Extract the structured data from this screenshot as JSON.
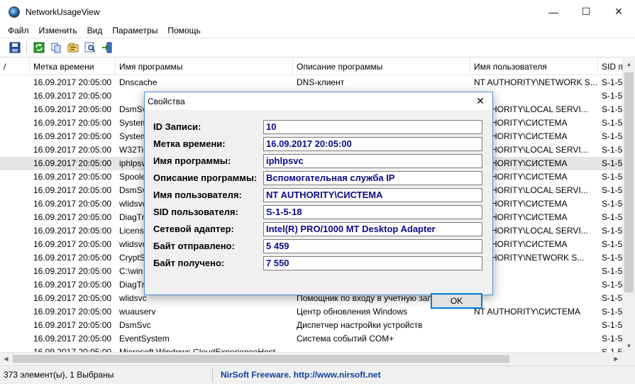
{
  "window": {
    "title": "NetworkUsageView",
    "minimize": "—",
    "maximize": "☐",
    "close": "✕"
  },
  "menu": [
    "Файл",
    "Изменить",
    "Вид",
    "Параметры",
    "Помощь"
  ],
  "list": {
    "sort_indicator": "/",
    "columns": [
      "Метка времени",
      "Имя программы",
      "Описание программы",
      "Имя пользователя",
      "SID п"
    ],
    "rows": [
      [
        "16.09.2017 20:05:00",
        "Dnscache",
        "DNS-клиент",
        "NT AUTHORITY\\NETWORK S...",
        "S-1-5"
      ],
      [
        "16.09.2017 20:05:00",
        "",
        "",
        "",
        "S-1-5"
      ],
      [
        "16.09.2017 20:05:00",
        "DsmSv",
        "",
        "AUTHORITY\\LOCAL SERVI...",
        "S-1-5"
      ],
      [
        "16.09.2017 20:05:00",
        "System",
        "",
        "AUTHORITY\\СИСТЕМА",
        "S-1-5"
      ],
      [
        "16.09.2017 20:05:00",
        "System",
        "",
        "AUTHORITY\\СИСТЕМА",
        "S-1-5"
      ],
      [
        "16.09.2017 20:05:00",
        "W32Tin",
        "",
        "AUTHORITY\\LOCAL SERVI...",
        "S-1-5"
      ],
      [
        "16.09.2017 20:05:00",
        "iphlpsv",
        "",
        "AUTHORITY\\СИСТЕМА",
        "S-1-5"
      ],
      [
        "16.09.2017 20:05:00",
        "Spoole",
        "",
        "AUTHORITY\\СИСТЕМА",
        "S-1-5"
      ],
      [
        "16.09.2017 20:05:00",
        "DsmSv",
        "",
        "AUTHORITY\\LOCAL SERVI...",
        "S-1-5"
      ],
      [
        "16.09.2017 20:05:00",
        "wlidsvc",
        "",
        "AUTHORITY\\СИСТЕМА",
        "S-1-5"
      ],
      [
        "16.09.2017 20:05:00",
        "DiagTr",
        "",
        "AUTHORITY\\СИСТЕМА",
        "S-1-5"
      ],
      [
        "16.09.2017 20:05:00",
        "License",
        "",
        "AUTHORITY\\LOCAL SERVI...",
        "S-1-5"
      ],
      [
        "16.09.2017 20:05:00",
        "wlidsvc",
        "",
        "AUTHORITY\\СИСТЕМА",
        "S-1-5"
      ],
      [
        "16.09.2017 20:05:00",
        "CryptS",
        "",
        "AUTHORITY\\NETWORK S...",
        "S-1-5"
      ],
      [
        "16.09.2017 20:05:00",
        "C:\\win",
        "",
        "",
        "S-1-5"
      ],
      [
        "16.09.2017 20:05:00",
        "DiagTr",
        "",
        "",
        "S-1-5"
      ],
      [
        "16.09.2017 20:05:00",
        "wlidsvc",
        "Помощник по входу в учетную запись М...",
        "",
        "S-1-5"
      ],
      [
        "16.09.2017 20:05:00",
        "wuauserv",
        "Центр обновления Windows",
        "NT AUTHORITY\\СИСТЕМА",
        "S-1-5"
      ],
      [
        "16.09.2017 20:05:00",
        "DsmSvc",
        "Диспетчер настройки устройств",
        "",
        "S-1-5"
      ],
      [
        "16.09.2017 20:05:00",
        "EventSystem",
        "Система событий COM+",
        "",
        "S-1-5"
      ],
      [
        "16.09.2017 20:05:00",
        "Microsoft.Windows.CloudExperienceHost",
        "",
        "",
        "S-1-5"
      ]
    ],
    "selected_row": 6
  },
  "status": {
    "count": "373 элемент(ы), 1 Выбраны",
    "link": "NirSoft Freeware.  http://www.nirsoft.net"
  },
  "dialog": {
    "title": "Свойства",
    "close": "✕",
    "fields": [
      {
        "label": "ID Записи:",
        "value": "10"
      },
      {
        "label": "Метка времени:",
        "value": "16.09.2017 20:05:00"
      },
      {
        "label": "Имя программы:",
        "value": "iphlpsvc"
      },
      {
        "label": "Описание программы:",
        "value": "Вспомогательная служба IP"
      },
      {
        "label": "Имя пользователя:",
        "value": "NT AUTHORITY\\СИСТЕМА"
      },
      {
        "label": "SID пользователя:",
        "value": "S-1-5-18"
      },
      {
        "label": "Сетевой адаптер:",
        "value": "Intel(R) PRO/1000 MT Desktop Adapter"
      },
      {
        "label": "Байт отправлено:",
        "value": "5  459"
      },
      {
        "label": "Байт получено:",
        "value": "7  550"
      }
    ],
    "ok_label": "OK"
  },
  "toolbar_icons": [
    "save-icon",
    "refresh-icon",
    "copy-icon",
    "properties-icon",
    "find-icon",
    "exit-icon"
  ]
}
